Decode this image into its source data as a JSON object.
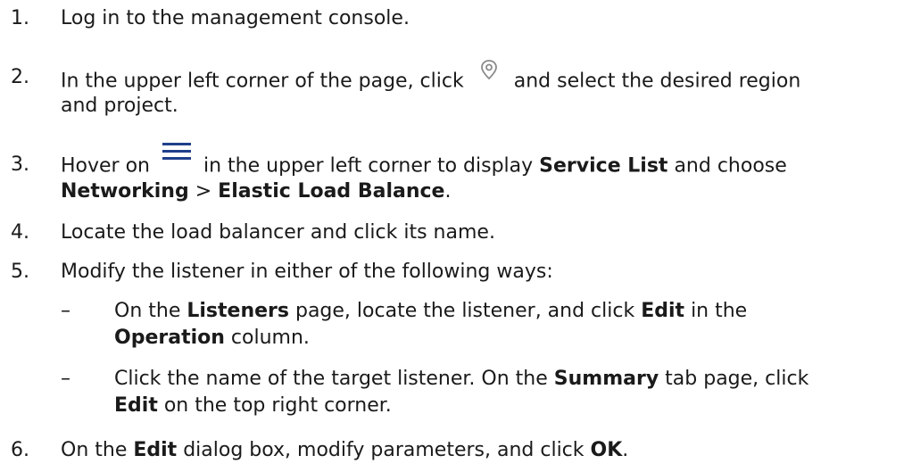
{
  "steps": [
    {
      "num": "1.",
      "text": "Log in to the management console."
    },
    {
      "num": "2.",
      "line1_before": "In the upper left corner of the page, click",
      "line1_after": "and select the desired region",
      "line2": "and project.",
      "icon": "location-pin-icon"
    },
    {
      "num": "3.",
      "p1": "Hover on",
      "p2": "in the upper left corner to display",
      "b1": "Service List",
      "p3": "and choose",
      "b2": "Networking",
      "p4": ">",
      "b3": "Elastic Load Balance",
      "p5": ".",
      "icon": "menu-icon"
    },
    {
      "num": "4.",
      "text": "Locate the load balancer and click its name."
    },
    {
      "num": "5.",
      "text": "Modify the listener in either of the following ways:",
      "subs": [
        {
          "dash": "–",
          "p1": "On the",
          "b1": "Listeners",
          "p2": "page, locate the listener, and click",
          "b2": "Edit",
          "p3": "in the",
          "b3": "Operation",
          "p4": "column."
        },
        {
          "dash": "–",
          "p1": "Click the name of the target listener. On the",
          "b1": "Summary",
          "p2": "tab page, click",
          "b2": "Edit",
          "p3": "on the top right corner."
        }
      ]
    },
    {
      "num": "6.",
      "p1": "On the",
      "b1": "Edit",
      "p2": "dialog box, modify parameters, and click",
      "b2": "OK",
      "p3": "."
    }
  ]
}
